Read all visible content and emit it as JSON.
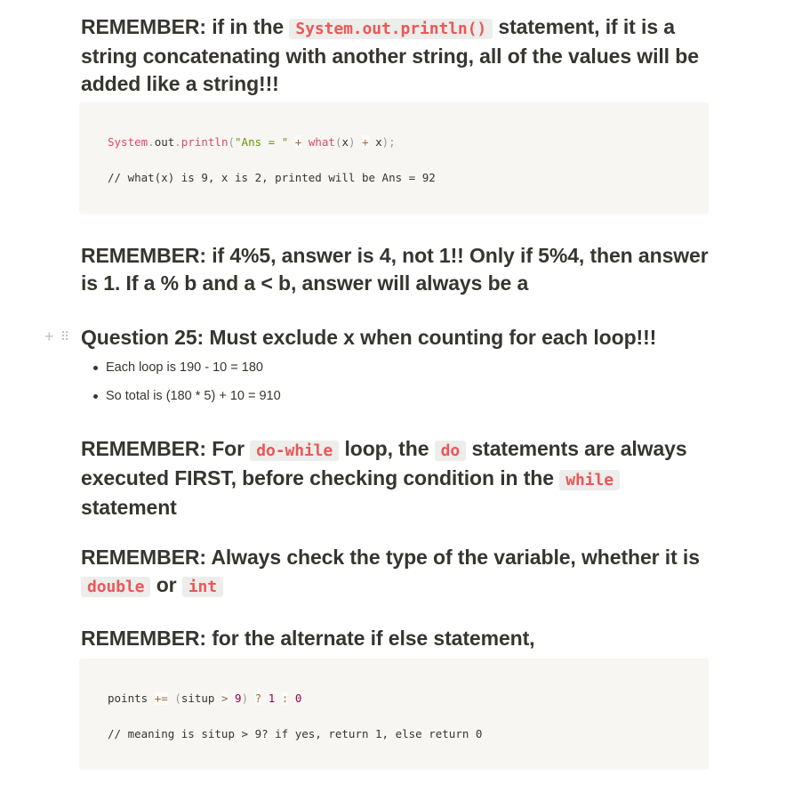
{
  "blocks": {
    "h1": {
      "a": "REMEMBER: if in the ",
      "code": "System.out.println()",
      "b": " statement, if it is a string concatenating with another string, all of the values will be added like a string!!!"
    },
    "code1": {
      "line1": [
        {
          "t": "System",
          "c": "fn"
        },
        {
          "t": ".",
          "c": "pn"
        },
        {
          "t": "out",
          "c": "tx"
        },
        {
          "t": ".",
          "c": "pn"
        },
        {
          "t": "println",
          "c": "fn"
        },
        {
          "t": "(",
          "c": "pn"
        },
        {
          "t": "\"Ans = \"",
          "c": "str"
        },
        {
          "t": " ",
          "c": "tx"
        },
        {
          "t": "+",
          "c": "op"
        },
        {
          "t": " ",
          "c": "tx"
        },
        {
          "t": "what",
          "c": "fn"
        },
        {
          "t": "(",
          "c": "pn"
        },
        {
          "t": "x",
          "c": "tx"
        },
        {
          "t": ")",
          "c": "pn"
        },
        {
          "t": " ",
          "c": "tx"
        },
        {
          "t": "+",
          "c": "op"
        },
        {
          "t": " x",
          "c": "tx"
        },
        {
          "t": ");",
          "c": "pn"
        }
      ],
      "line2": "// what(x) is 9, x is 2, printed will be Ans = 92"
    },
    "h2": "REMEMBER: if 4%5, answer is 4, not 1!! Only if 5%4, then answer is 1. If a % b and a < b, answer will always be a",
    "h3": "Question 25: Must exclude x when counting for each loop!!!",
    "bullets": [
      "Each loop is 190 - 10 = 180",
      "So total is (180 * 5) + 10 = 910"
    ],
    "h4": {
      "a": "REMEMBER: For ",
      "code1": "do-while",
      "b": " loop, the ",
      "code2": "do",
      "c": " statements are always executed FIRST, before checking condition in the ",
      "code3": "while",
      "d": " statement"
    },
    "h5": {
      "a": "REMEMBER: Always check the type of the variable, whether it is ",
      "code1": "double",
      "b": " or ",
      "code2": "int"
    },
    "h6": "REMEMBER: for the alternate if else statement,",
    "code2": {
      "line1": [
        {
          "t": "points ",
          "c": "tx"
        },
        {
          "t": "+=",
          "c": "op"
        },
        {
          "t": " ",
          "c": "tx"
        },
        {
          "t": "(",
          "c": "pn"
        },
        {
          "t": "situp ",
          "c": "tx"
        },
        {
          "t": ">",
          "c": "op"
        },
        {
          "t": " ",
          "c": "tx"
        },
        {
          "t": "9",
          "c": "num"
        },
        {
          "t": ")",
          "c": "pn"
        },
        {
          "t": " ",
          "c": "tx"
        },
        {
          "t": "?",
          "c": "op"
        },
        {
          "t": " ",
          "c": "tx"
        },
        {
          "t": "1",
          "c": "num"
        },
        {
          "t": " ",
          "c": "tx"
        },
        {
          "t": ":",
          "c": "op"
        },
        {
          "t": " ",
          "c": "tx"
        },
        {
          "t": "0",
          "c": "num"
        }
      ],
      "line2": "// meaning is situp > 9? if yes, return 1, else return 0"
    }
  }
}
